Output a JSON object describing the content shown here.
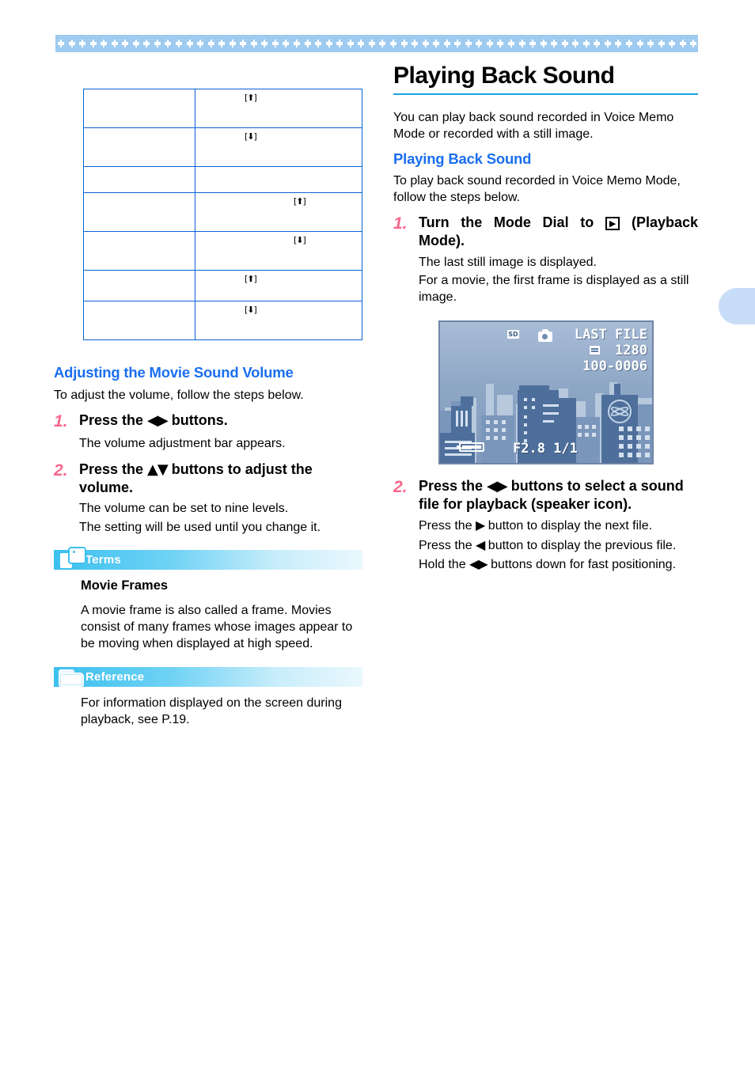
{
  "decor": {
    "top_band_motif": "diamond-flower-motif",
    "page_tab": "page-edge-tab"
  },
  "table": {
    "rows": [
      {
        "left": "",
        "right_icon": "[⬆]",
        "icon_pos": "a",
        "height": "tall"
      },
      {
        "left": "",
        "right_icon": "[⬇]",
        "icon_pos": "a",
        "height": "tall"
      },
      {
        "left": "",
        "right_icon": "",
        "icon_pos": "a",
        "height": "short"
      },
      {
        "left": "",
        "right_icon": "[⬆]",
        "icon_pos": "b",
        "height": "tall"
      },
      {
        "left": "",
        "right_icon": "[⬇]",
        "icon_pos": "b",
        "height": "tall"
      },
      {
        "left": "",
        "right_icon": "[⬆]",
        "icon_pos": "a",
        "height": ""
      },
      {
        "left": "",
        "right_icon": "[⬇]",
        "icon_pos": "a",
        "height": "tall"
      }
    ]
  },
  "left": {
    "heading": "Adjusting the Movie Sound Volume",
    "intro": "To adjust the volume, follow the steps below.",
    "steps": [
      {
        "num": "1.",
        "title_pre": "Press the ",
        "title_glyph": "◀▶",
        "title_post": " buttons.",
        "body": [
          "The volume adjustment bar appears."
        ]
      },
      {
        "num": "2.",
        "title_pre": "Press the ",
        "title_glyph": "▲▼",
        "title_post": " buttons to adjust the volume.",
        "body": [
          "The volume can be set to nine levels.",
          "The setting will be used until you change it."
        ]
      }
    ],
    "terms_box": {
      "label": "Terms",
      "icon": "speech-bubbles-icon",
      "term_title": "Movie Frames",
      "term_text": "A movie frame is also called a frame. Movies consist of many frames whose images appear to be moving when displayed at high speed."
    },
    "reference_box": {
      "label": "Reference",
      "icon": "folder-icon",
      "text": "For information displayed on the screen during playback, see P.19."
    }
  },
  "right": {
    "title": "Playing Back Sound",
    "intro": "You can play back sound recorded in Voice Memo Mode or recorded with a still image.",
    "sub_heading": "Playing Back Sound",
    "sub_intro": "To play back sound recorded in Voice Memo Mode, follow the steps below.",
    "step1": {
      "num": "1.",
      "title_pre": "Turn the Mode Dial to ",
      "title_glyph": "▶",
      "title_post": " (Playback Mode).",
      "body": [
        "The last still image is displayed.",
        "For a movie, the first frame is displayed as a still image."
      ]
    },
    "step2": {
      "num": "2.",
      "title_pre": "Press the ",
      "title_glyph": "◀▶",
      "title_post": " buttons to select a sound file for playback (speaker icon).",
      "body": [
        {
          "pre": "Press the ",
          "glyph": "▶",
          "post": " button to display the next file."
        },
        {
          "pre": "Press the ",
          "glyph": "◀",
          "post": " button to display the previous file."
        },
        {
          "pre": "Hold the ",
          "glyph": "◀▶",
          "post": " buttons down for fast positioning."
        }
      ]
    },
    "lcd": {
      "sd_label": "SD",
      "camera_icon": "camera-icon",
      "quality_icon": "image-quality-icon",
      "last_file": "LAST FILE",
      "resolution": "1280",
      "file_number": "100-0006",
      "aperture_shutter": "F2.8 1/1",
      "battery_icon": "battery-icon",
      "building_logo": "globe-logo-icon"
    }
  },
  "colors": {
    "accent_blue": "#1a6ef0",
    "rule_blue": "#1aa3e0",
    "table_border": "#0a63d6",
    "step_number_pink": "#f9678c",
    "band_blue": "#9ecbef",
    "tab_blue": "#c8ddf7"
  }
}
